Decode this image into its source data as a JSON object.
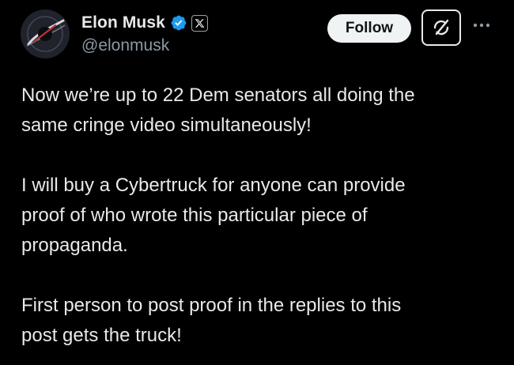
{
  "author": {
    "display_name": "Elon Musk",
    "handle": "@elonmusk",
    "verified_icon": "verified-badge-icon",
    "affiliation_icon": "x-logo-icon",
    "avatar_icon": "avatar-image"
  },
  "actions": {
    "follow_label": "Follow",
    "grok_icon": "grok-icon",
    "more_icon": "more-options-icon"
  },
  "tweet": {
    "paragraphs": [
      "Now we’re up to 22 Dem senators all doing the\nsame cringe video simultaneously!",
      "I will buy a Cybertruck for anyone can provide\nproof of who wrote this particular piece of\npropaganda.",
      "First person to post proof in the replies to this\npost gets the truck!"
    ]
  },
  "colors": {
    "background": "#000000",
    "text": "#e7e9ea",
    "muted": "#8b98a5",
    "verified": "#1d9bf0",
    "follow_bg": "#eff3f4"
  }
}
